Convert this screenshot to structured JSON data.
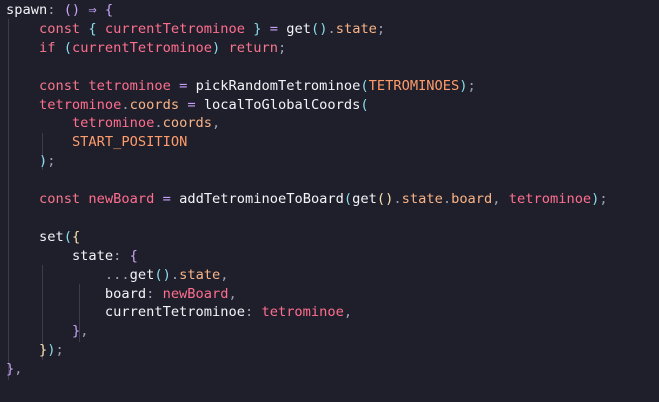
{
  "editor": {
    "theme": {
      "background": "#1e1f2a",
      "default": "#e0e2ea",
      "keyword": "#f7768e",
      "variable": "#ff6e8e",
      "property": "#fab387",
      "constant": "#ff9c6b",
      "punctuation": "#9aa0b6",
      "operator": "#c6a0f6",
      "brace1": "#f9e2af",
      "brace2": "#cba6f7",
      "brace3": "#89dceb"
    },
    "lines": [
      [
        {
          "t": "spawn",
          "c": "tok-fn"
        },
        {
          "t": ": ",
          "c": "tok-punc"
        },
        {
          "t": "()",
          "c": "tok-brace2"
        },
        {
          "t": " ⇒ ",
          "c": "tok-op"
        },
        {
          "t": "{",
          "c": "tok-brace2"
        }
      ],
      [
        {
          "t": "    "
        },
        {
          "t": "const",
          "c": "tok-kw"
        },
        {
          "t": " "
        },
        {
          "t": "{",
          "c": "tok-brace3"
        },
        {
          "t": " "
        },
        {
          "t": "currentTetrominoe",
          "c": "tok-var"
        },
        {
          "t": " "
        },
        {
          "t": "}",
          "c": "tok-brace3"
        },
        {
          "t": " = ",
          "c": "tok-op"
        },
        {
          "t": "get",
          "c": "tok-fn"
        },
        {
          "t": "()",
          "c": "tok-brace3"
        },
        {
          "t": ".",
          "c": "tok-punc"
        },
        {
          "t": "state",
          "c": "tok-prop"
        },
        {
          "t": ";",
          "c": "tok-punc"
        }
      ],
      [
        {
          "t": "    "
        },
        {
          "t": "if",
          "c": "tok-kw"
        },
        {
          "t": " "
        },
        {
          "t": "(",
          "c": "tok-brace3"
        },
        {
          "t": "currentTetrominoe",
          "c": "tok-var"
        },
        {
          "t": ")",
          "c": "tok-brace3"
        },
        {
          "t": " "
        },
        {
          "t": "return",
          "c": "tok-kw"
        },
        {
          "t": ";",
          "c": "tok-punc"
        }
      ],
      [],
      [
        {
          "t": "    "
        },
        {
          "t": "const",
          "c": "tok-kw"
        },
        {
          "t": " "
        },
        {
          "t": "tetrominoe",
          "c": "tok-var"
        },
        {
          "t": " = ",
          "c": "tok-op"
        },
        {
          "t": "pickRandomTetrominoe",
          "c": "tok-fn"
        },
        {
          "t": "(",
          "c": "tok-brace3"
        },
        {
          "t": "TETROMINOES",
          "c": "tok-const"
        },
        {
          "t": ")",
          "c": "tok-brace3"
        },
        {
          "t": ";",
          "c": "tok-punc"
        }
      ],
      [
        {
          "t": "    "
        },
        {
          "t": "tetrominoe",
          "c": "tok-var"
        },
        {
          "t": ".",
          "c": "tok-punc"
        },
        {
          "t": "coords",
          "c": "tok-prop"
        },
        {
          "t": " = ",
          "c": "tok-op"
        },
        {
          "t": "localToGlobalCoords",
          "c": "tok-fn"
        },
        {
          "t": "(",
          "c": "tok-brace3"
        }
      ],
      [
        {
          "t": "        "
        },
        {
          "t": "tetrominoe",
          "c": "tok-var"
        },
        {
          "t": ".",
          "c": "tok-punc"
        },
        {
          "t": "coords",
          "c": "tok-prop"
        },
        {
          "t": ",",
          "c": "tok-punc"
        }
      ],
      [
        {
          "t": "        "
        },
        {
          "t": "START_POSITION",
          "c": "tok-const"
        }
      ],
      [
        {
          "t": "    "
        },
        {
          "t": ")",
          "c": "tok-brace3"
        },
        {
          "t": ";",
          "c": "tok-punc"
        }
      ],
      [],
      [
        {
          "t": "    "
        },
        {
          "t": "const",
          "c": "tok-kw"
        },
        {
          "t": " "
        },
        {
          "t": "newBoard",
          "c": "tok-var"
        },
        {
          "t": " = ",
          "c": "tok-op"
        },
        {
          "t": "addTetrominoeToBoard",
          "c": "tok-fn"
        },
        {
          "t": "(",
          "c": "tok-brace3"
        },
        {
          "t": "get",
          "c": "tok-fn"
        },
        {
          "t": "()",
          "c": "tok-brace1"
        },
        {
          "t": ".",
          "c": "tok-punc"
        },
        {
          "t": "state",
          "c": "tok-prop"
        },
        {
          "t": ".",
          "c": "tok-punc"
        },
        {
          "t": "board",
          "c": "tok-prop"
        },
        {
          "t": ", ",
          "c": "tok-punc"
        },
        {
          "t": "tetrominoe",
          "c": "tok-var"
        },
        {
          "t": ")",
          "c": "tok-brace3"
        },
        {
          "t": ";",
          "c": "tok-punc"
        }
      ],
      [],
      [
        {
          "t": "    "
        },
        {
          "t": "set",
          "c": "tok-fn"
        },
        {
          "t": "(",
          "c": "tok-brace3"
        },
        {
          "t": "{",
          "c": "tok-brace1"
        }
      ],
      [
        {
          "t": "        "
        },
        {
          "t": "state",
          "c": "tok-fn"
        },
        {
          "t": ": ",
          "c": "tok-punc"
        },
        {
          "t": "{",
          "c": "tok-brace2"
        }
      ],
      [
        {
          "t": "            "
        },
        {
          "t": "...",
          "c": "tok-punc"
        },
        {
          "t": "get",
          "c": "tok-fn"
        },
        {
          "t": "()",
          "c": "tok-brace3"
        },
        {
          "t": ".",
          "c": "tok-punc"
        },
        {
          "t": "state",
          "c": "tok-prop"
        },
        {
          "t": ",",
          "c": "tok-punc"
        }
      ],
      [
        {
          "t": "            "
        },
        {
          "t": "board",
          "c": "tok-fn"
        },
        {
          "t": ": ",
          "c": "tok-punc"
        },
        {
          "t": "newBoard",
          "c": "tok-var"
        },
        {
          "t": ",",
          "c": "tok-punc"
        }
      ],
      [
        {
          "t": "            "
        },
        {
          "t": "currentTetrominoe",
          "c": "tok-fn"
        },
        {
          "t": ": ",
          "c": "tok-punc"
        },
        {
          "t": "tetrominoe",
          "c": "tok-var"
        },
        {
          "t": ",",
          "c": "tok-punc"
        }
      ],
      [
        {
          "t": "        "
        },
        {
          "t": "}",
          "c": "tok-brace2"
        },
        {
          "t": ",",
          "c": "tok-punc"
        }
      ],
      [
        {
          "t": "    "
        },
        {
          "t": "}",
          "c": "tok-brace1"
        },
        {
          "t": ")",
          "c": "tok-brace3"
        },
        {
          "t": ";",
          "c": "tok-punc"
        }
      ],
      [
        {
          "t": "}",
          "c": "tok-brace2"
        },
        {
          "t": ",",
          "c": "tok-punc"
        }
      ]
    ]
  }
}
